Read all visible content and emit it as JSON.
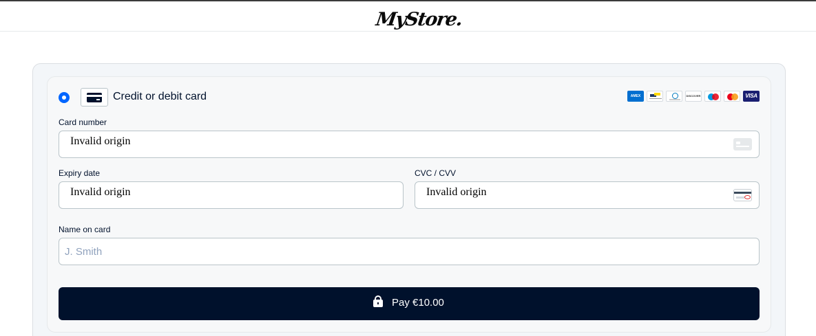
{
  "header": {
    "logo_text": "MyStore."
  },
  "payment_method": {
    "title": "Credit or debit card",
    "selected": true,
    "card_icon": "credit-card-icon",
    "brands": [
      {
        "name": "amex",
        "label": "AMEX"
      },
      {
        "name": "bancontact",
        "label": ""
      },
      {
        "name": "diners",
        "label": ""
      },
      {
        "name": "discover",
        "label": "DISCOVER"
      },
      {
        "name": "maestro",
        "label": ""
      },
      {
        "name": "mastercard",
        "label": ""
      },
      {
        "name": "visa",
        "label": "VISA"
      }
    ]
  },
  "form": {
    "card_number": {
      "label": "Card number",
      "value": "Invalid origin"
    },
    "expiry": {
      "label": "Expiry date",
      "value": "Invalid origin"
    },
    "cvc": {
      "label": "CVC / CVV",
      "value": "Invalid origin"
    },
    "name": {
      "label": "Name on card",
      "placeholder": "J. Smith",
      "value": ""
    }
  },
  "pay_button": {
    "label": "Pay €10.00",
    "icon": "lock-icon"
  },
  "colors": {
    "primary": "#00112c",
    "accent": "#0066ff",
    "panel_bg": "#f3f6f9",
    "border": "#b9c4c9"
  }
}
